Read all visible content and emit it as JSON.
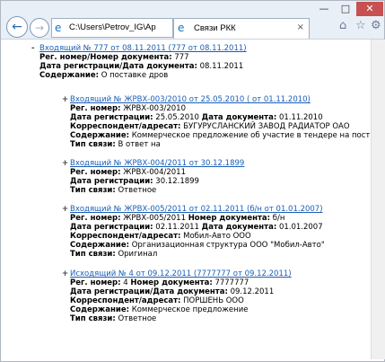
{
  "browser": {
    "address_url": "C:\\Users\\Petrov_IG\\Ap",
    "tab_title": "Связи РКК",
    "min_glyph": "—",
    "max_glyph": "□",
    "close_glyph": "✕",
    "back_glyph": "←",
    "forward_glyph": "→",
    "ie_glyph": "e",
    "tab_close_glyph": "×",
    "home_glyph": "⌂",
    "star_glyph": "☆",
    "gear_glyph": "⚙"
  },
  "main": {
    "toggle": "-",
    "link": "Входящий № 777 от 08.11.2011 (777 от 08.11.2011)",
    "l1_label": "Рег. номер/Номер документа:",
    "l1_value": "777",
    "l2_label": "Дата регистрации/Дата документа:",
    "l2_value": "08.11.2011",
    "l3_label": "Содержание:",
    "l3_value": "О поставке дров"
  },
  "r1": {
    "toggle": "+",
    "link": "Входящий № ЖРВХ-003/2010 от 25.05.2010 ( от 01.11.2010)",
    "reg_label": "Рег. номер:",
    "reg_value": "ЖРВХ-003/2010",
    "date_label": "Дата регистрации:",
    "date_value": "25.05.2010",
    "docdate_label": "Дата документа:",
    "docdate_value": "01.11.2010",
    "corr_label": "Корреспондент/адресат:",
    "corr_value": "БУГУРУСЛАНСКИЙ ЗАВОД РАДИАТОР ОАО",
    "content_label": "Содержание:",
    "content_value": "Коммерческое предложение об участие в тендере на поставку",
    "type_label": "Тип связи:",
    "type_value": "В ответ на"
  },
  "r2": {
    "toggle": "+",
    "link": "Входящий № ЖРВХ-004/2011 от 30.12.1899",
    "reg_label": "Рег. номер:",
    "reg_value": "ЖРВХ-004/2011",
    "date_label": "Дата регистрации:",
    "date_value": "30.12.1899",
    "type_label": "Тип связи:",
    "type_value": "Ответное"
  },
  "r3": {
    "toggle": "+",
    "link": "Входящий № ЖРВХ-005/2011 от 02.11.2011 (б/н от 01.01.2007)",
    "reg_label": "Рег. номер:",
    "reg_value": "ЖРВХ-005/2011",
    "docnum_label": "Номер документа:",
    "docnum_value": "б/н",
    "date_label": "Дата регистрации:",
    "date_value": "02.11.2011",
    "docdate_label": "Дата документа:",
    "docdate_value": "01.01.2007",
    "corr_label": "Корреспондент/адресат:",
    "corr_value": "Мобил-Авто ООО",
    "content_label": "Содержание:",
    "content_value": "Организационная структура ООО \"Мобил-Авто\"",
    "type_label": "Тип связи:",
    "type_value": "Оригинал"
  },
  "r4": {
    "toggle": "+",
    "link": "Исходящий № 4 от 09.12.2011 (7777777 от 09.12.2011)",
    "reg_label": "Рег. номер:",
    "reg_value": "4",
    "docnum_label": "Номер документа:",
    "docnum_value": "7777777",
    "date_label": "Дата регистрации/Дата документа:",
    "date_value": "09.12.2011",
    "corr_label": "Корреспондент/адресат:",
    "corr_value": "ПОРШЕНЬ ООО",
    "content_label": "Содержание:",
    "content_value": "Коммерческое предложение",
    "type_label": "Тип связи:",
    "type_value": "Ответное"
  }
}
